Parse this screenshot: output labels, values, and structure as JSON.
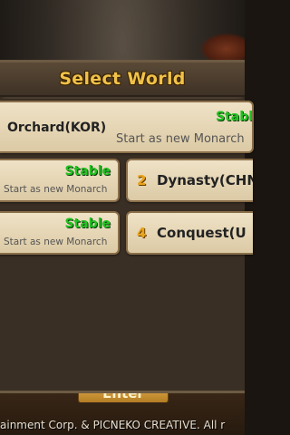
{
  "dialog": {
    "title": "Select World"
  },
  "featured_world": {
    "name": "Orchard(KOR)",
    "status": "Stable",
    "subtitle": "Start as new Monarch"
  },
  "worlds": [
    {
      "number": "",
      "name": "",
      "status": "Stable",
      "subtitle": "Start as new Monarch"
    },
    {
      "number": "2",
      "name": "Dynasty(CHN",
      "status": "",
      "subtitle": ""
    },
    {
      "number": "",
      "name": "",
      "status": "Stable",
      "subtitle": "Start as new Monarch"
    },
    {
      "number": "4",
      "name": "Conquest(U",
      "status": "",
      "subtitle": ""
    }
  ],
  "footer": {
    "enter_label": "Enter",
    "copyright": "ainment Corp. & PICNEKO CREATIVE. All r"
  },
  "colors": {
    "title": "#f0c24a",
    "status_stable": "#22c322",
    "number": "#e8a21c",
    "card": "#efe2c6"
  }
}
